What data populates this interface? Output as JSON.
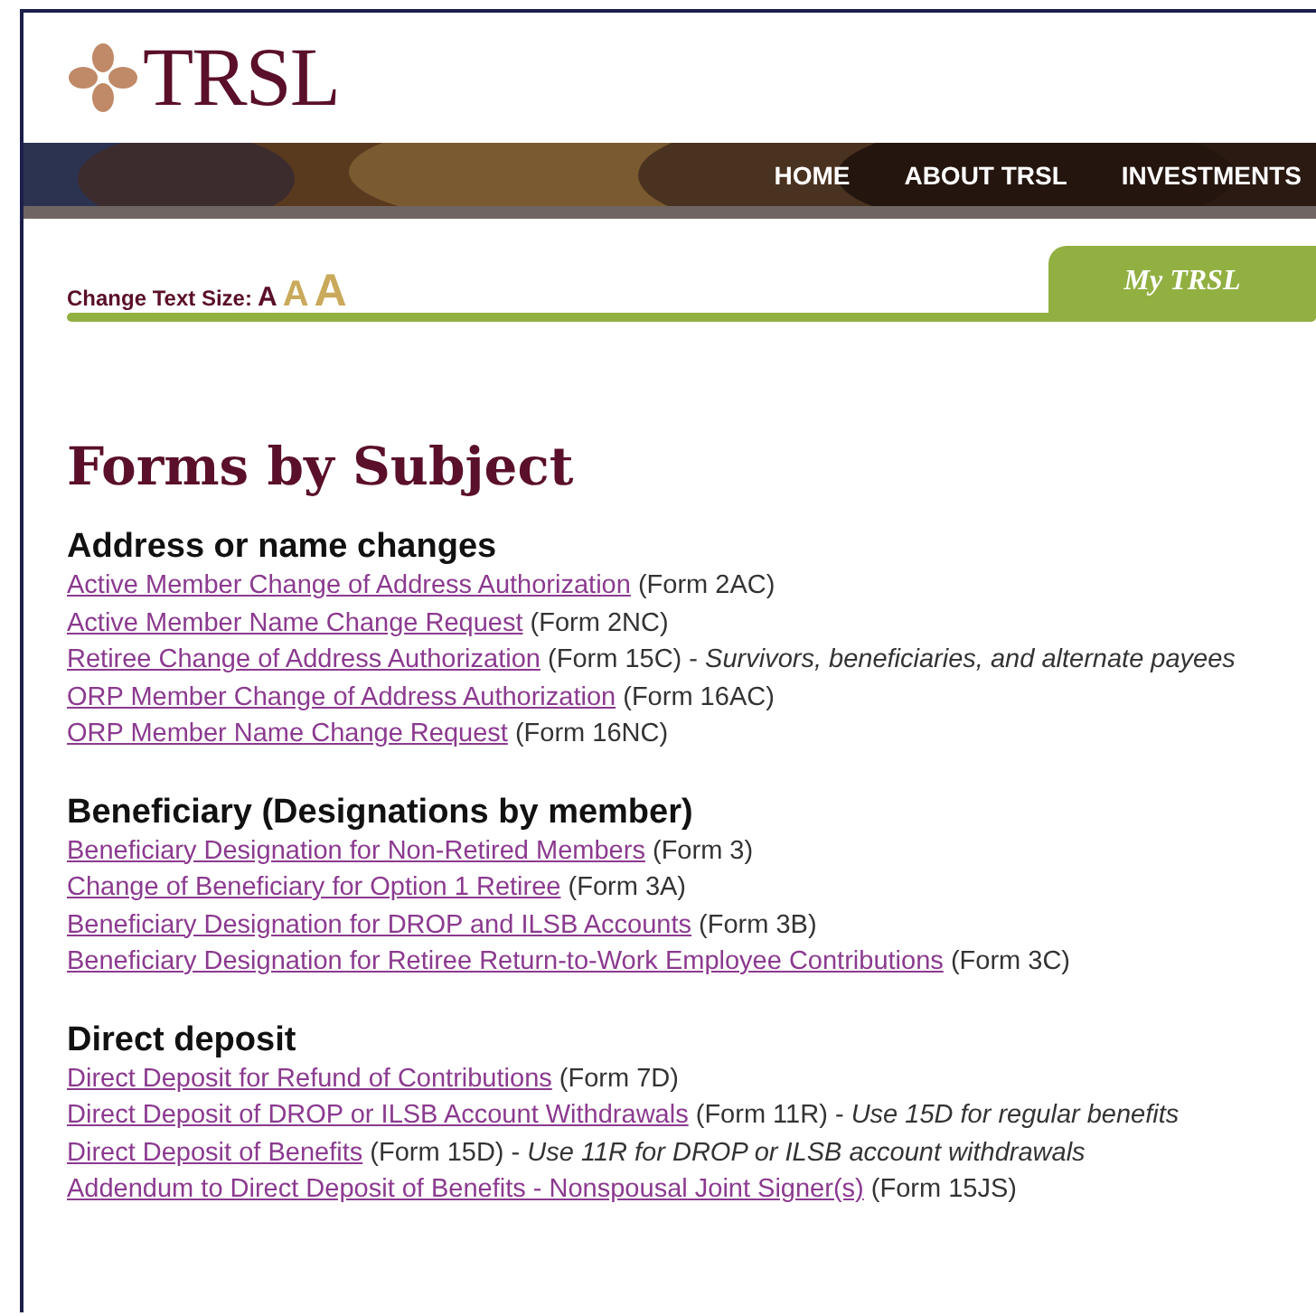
{
  "logo": {
    "text": "TRSL"
  },
  "nav": [
    {
      "label": "HOME"
    },
    {
      "label": "ABOUT TRSL"
    },
    {
      "label": "INVESTMENTS"
    }
  ],
  "text_size": {
    "label": "Change Text Size:",
    "options": [
      {
        "label": "A",
        "selected": true
      },
      {
        "label": "A",
        "selected": false
      },
      {
        "label": "A",
        "selected": false
      }
    ]
  },
  "tab": {
    "label": "My TRSL"
  },
  "title": "Forms by Subject",
  "sections": [
    {
      "heading": "Address or name changes",
      "items": [
        {
          "link": "Active Member Change of Address Authorization",
          "form": "(Form 2AC)"
        },
        {
          "link": "Active Member Name Change Request",
          "form": "(Form 2NC)"
        },
        {
          "link": "Retiree Change of Address Authorization",
          "form": "(Form 15C) -",
          "note": "Survivors, beneficiaries, and alternate payees"
        },
        {
          "link": "ORP Member Change of Address Authorization",
          "form": "(Form 16AC)"
        },
        {
          "link": "ORP Member Name Change Request",
          "form": "(Form 16NC)"
        }
      ]
    },
    {
      "heading": "Beneficiary (Designations by member)",
      "items": [
        {
          "link": "Beneficiary Designation for Non-Retired Members",
          "form": "(Form 3)"
        },
        {
          "link": "Change of Beneficiary for Option 1 Retiree",
          "form": "(Form 3A)"
        },
        {
          "link": "Beneficiary Designation for DROP and ILSB Accounts",
          "form": "(Form 3B)"
        },
        {
          "link": "Beneficiary Designation for Retiree Return-to-Work Employee Contributions",
          "form": "(Form 3C)"
        }
      ]
    },
    {
      "heading": "Direct deposit",
      "items": [
        {
          "link": "Direct Deposit for Refund of Contributions",
          "form": "(Form 7D)"
        },
        {
          "link": "Direct Deposit of DROP or ILSB Account Withdrawals",
          "form": "(Form 11R) -",
          "note": "Use 15D for regular benefits"
        },
        {
          "link": "Direct Deposit of Benefits",
          "form": "(Form 15D) -",
          "note": "Use 11R for DROP or ILSB account withdrawals"
        },
        {
          "link": "Addendum to Direct Deposit of Benefits - Nonspousal Joint Signer(s)",
          "form": "(Form 15JS)"
        }
      ]
    }
  ]
}
